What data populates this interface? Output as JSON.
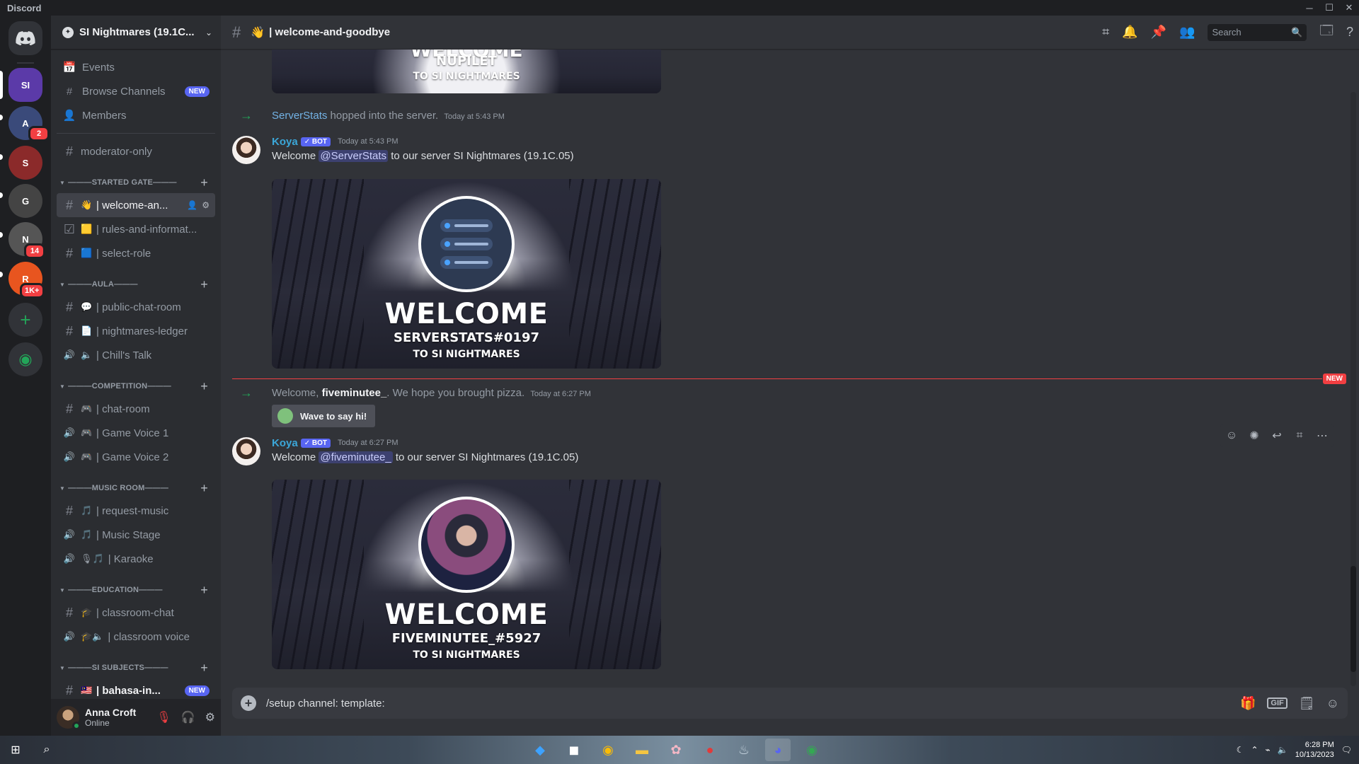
{
  "window": {
    "app_name": "Discord",
    "controls": [
      "─",
      "☐",
      "✕"
    ]
  },
  "servers": [
    {
      "name": "discord-home",
      "label": "DC",
      "color": "#313338"
    },
    {
      "name": "si-nightmares",
      "label": "SI",
      "color": "#5b3aa8"
    },
    {
      "name": "server-2",
      "label": "A",
      "color": "#3a4a7a",
      "badge": "2"
    },
    {
      "name": "server-3",
      "label": "S",
      "color": "#8b2a2a"
    },
    {
      "name": "server-4",
      "label": "G",
      "color": "#444"
    },
    {
      "name": "server-5",
      "label": "N",
      "color": "#555",
      "badge": "14"
    },
    {
      "name": "server-6",
      "label": "R",
      "color": "#e8551f",
      "badge": "1K+"
    },
    {
      "name": "add-server",
      "label": "+",
      "color": "#313338"
    },
    {
      "name": "explore",
      "label": "◉",
      "color": "#313338"
    }
  ],
  "sidebar": {
    "server_name": "SI Nightmares (19.1C...",
    "nav": [
      {
        "icon": "📅",
        "label": "Events"
      },
      {
        "icon": "#",
        "label": "Browse Channels",
        "badge": "NEW"
      },
      {
        "icon": "👤",
        "label": "Members"
      }
    ],
    "top_channel": {
      "icon": "#",
      "label": "moderator-only"
    },
    "categories": [
      {
        "title": "———STARTED GATE———",
        "channels": [
          {
            "kind": "#",
            "emoji": "👋",
            "label": "| welcome-an...",
            "active": true
          },
          {
            "kind": "☑",
            "emoji": "🟨",
            "label": "| rules-and-informat..."
          },
          {
            "kind": "#",
            "emoji": "🟦",
            "label": "| select-role"
          }
        ]
      },
      {
        "title": "———AULA———",
        "channels": [
          {
            "kind": "#",
            "emoji": "💬",
            "label": "| public-chat-room"
          },
          {
            "kind": "#",
            "emoji": "📄",
            "label": "| nightmares-ledger"
          },
          {
            "kind": "🔊",
            "emoji": "🔈",
            "label": "| Chill's Talk"
          }
        ]
      },
      {
        "title": "———COMPETITION———",
        "channels": [
          {
            "kind": "#",
            "emoji": "🎮",
            "label": "| chat-room"
          },
          {
            "kind": "🔊",
            "emoji": "🎮",
            "label": "| Game Voice 1"
          },
          {
            "kind": "🔊",
            "emoji": "🎮",
            "label": "| Game Voice 2"
          }
        ]
      },
      {
        "title": "———MUSIC ROOM———",
        "channels": [
          {
            "kind": "#",
            "emoji": "🎵",
            "label": "| request-music"
          },
          {
            "kind": "🔊",
            "emoji": "🎵",
            "label": "| Music Stage"
          },
          {
            "kind": "🔊",
            "emoji": "🎙🎵",
            "label": "| Karaoke"
          }
        ]
      },
      {
        "title": "———EDUCATION———",
        "channels": [
          {
            "kind": "#",
            "emoji": "🎓",
            "label": "| classroom-chat"
          },
          {
            "kind": "🔊",
            "emoji": "🎓🔈",
            "label": "| classroom voice"
          }
        ]
      },
      {
        "title": "———SI SUBJECTS———",
        "channels": [
          {
            "kind": "#",
            "emoji": "🇲🇾",
            "label": "| bahasa-in...",
            "badge": "NEW"
          }
        ]
      }
    ],
    "user": {
      "name": "Anna Croft",
      "status": "Online"
    }
  },
  "channel_header": {
    "emoji": "👋",
    "title": "| welcome-and-goodbye",
    "search_placeholder": "Search"
  },
  "messages": {
    "partial_card": {
      "line1": "WELCOME",
      "line2": "NUPILET",
      "line3": "TO SI NIGHTMARES"
    },
    "sys1": {
      "user": "ServerStats",
      "text": "hopped into the server.",
      "time": "Today at 5:43 PM"
    },
    "msg1": {
      "author": "Koya",
      "badge": "✓ BOT",
      "time": "Today at 5:43 PM",
      "pre": "Welcome",
      "mention": "@ServerStats",
      "post": "to our server SI Nightmares (19.1C.05)",
      "card": {
        "line1": "WELCOME",
        "line2": "SERVERSTATS#0197",
        "line3": "TO SI NIGHTMARES"
      }
    },
    "divider_label": "NEW",
    "sys2": {
      "pre": "Welcome,",
      "user": "fiveminutee_",
      "text": ". We hope you brought pizza.",
      "time": "Today at 6:27 PM",
      "wave_label": "Wave to say hi!"
    },
    "msg2": {
      "author": "Koya",
      "badge": "✓ BOT",
      "time": "Today at 6:27 PM",
      "pre": "Welcome",
      "mention": "@fiveminutee_",
      "post": "to our server SI Nightmares (19.1C.05)",
      "card": {
        "line1": "WELCOME",
        "line2": "FIVEMINUTEE_#5927",
        "line3": "TO SI NIGHTMARES"
      }
    }
  },
  "composer": {
    "value": "/setup channel: template:"
  },
  "taskbar": {
    "time": "6:28 PM",
    "date": "10/13/2023"
  }
}
